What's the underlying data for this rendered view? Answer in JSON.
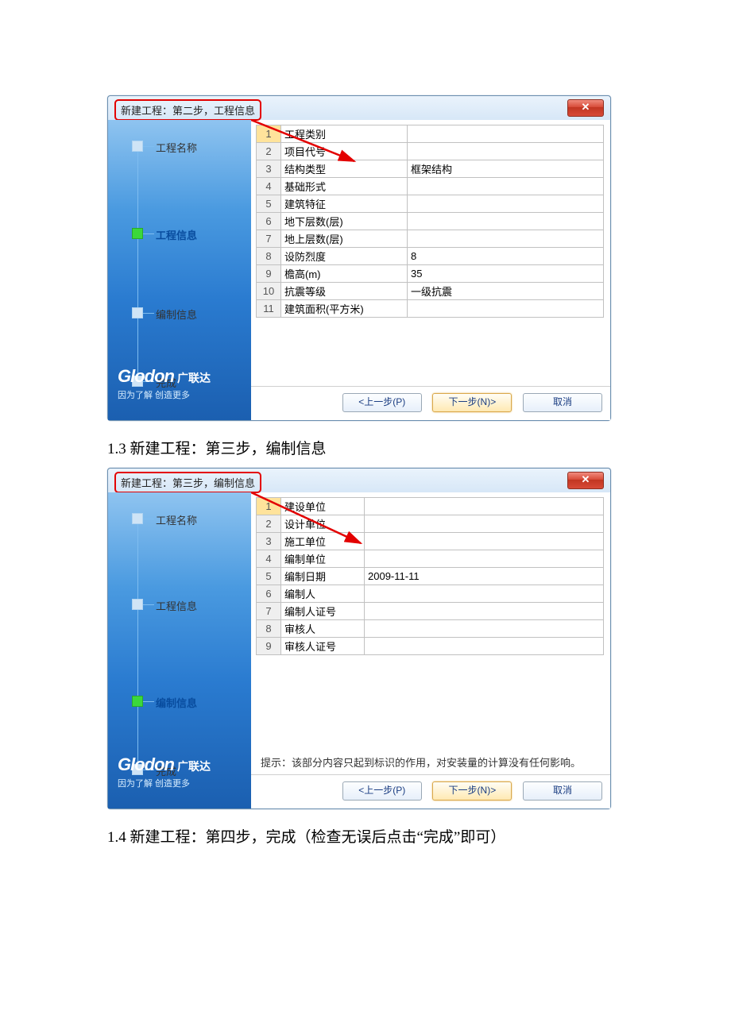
{
  "dialog1": {
    "title": "新建工程：第二步，工程信息",
    "close_glyph": "✕",
    "steps": [
      {
        "label": "工程名称",
        "active": false
      },
      {
        "label": "工程信息",
        "active": true
      },
      {
        "label": "编制信息",
        "active": false
      },
      {
        "label": "完成",
        "active": false
      }
    ],
    "rows": [
      {
        "n": "1",
        "label": "工程类别",
        "value": ""
      },
      {
        "n": "2",
        "label": "项目代号",
        "value": ""
      },
      {
        "n": "3",
        "label": "结构类型",
        "value": "框架结构"
      },
      {
        "n": "4",
        "label": "基础形式",
        "value": ""
      },
      {
        "n": "5",
        "label": "建筑特征",
        "value": ""
      },
      {
        "n": "6",
        "label": "地下层数(层)",
        "value": ""
      },
      {
        "n": "7",
        "label": "地上层数(层)",
        "value": ""
      },
      {
        "n": "8",
        "label": "设防烈度",
        "value": "8"
      },
      {
        "n": "9",
        "label": "檐高(m)",
        "value": "35"
      },
      {
        "n": "10",
        "label": "抗震等级",
        "value": "一级抗震"
      },
      {
        "n": "11",
        "label": "建筑面积(平方米)",
        "value": ""
      }
    ],
    "buttons": {
      "prev": "<上一步(P)",
      "next": "下一步(N)>",
      "cancel": "取消"
    },
    "brand": {
      "logo": "Glodon",
      "cn": "广联达",
      "sub": "因为了解 创造更多"
    }
  },
  "caption1": "1.3 新建工程：第三步，编制信息",
  "dialog2": {
    "title": "新建工程：第三步，编制信息",
    "close_glyph": "✕",
    "steps": [
      {
        "label": "工程名称",
        "active": false
      },
      {
        "label": "工程信息",
        "active": false
      },
      {
        "label": "编制信息",
        "active": true
      },
      {
        "label": "完成",
        "active": false
      }
    ],
    "rows": [
      {
        "n": "1",
        "label": "建设单位",
        "value": ""
      },
      {
        "n": "2",
        "label": "设计单位",
        "value": ""
      },
      {
        "n": "3",
        "label": "施工单位",
        "value": ""
      },
      {
        "n": "4",
        "label": "编制单位",
        "value": ""
      },
      {
        "n": "5",
        "label": "编制日期",
        "value": "2009-11-11"
      },
      {
        "n": "6",
        "label": "编制人",
        "value": ""
      },
      {
        "n": "7",
        "label": "编制人证号",
        "value": ""
      },
      {
        "n": "8",
        "label": "审核人",
        "value": ""
      },
      {
        "n": "9",
        "label": "审核人证号",
        "value": ""
      }
    ],
    "hint": "提示：该部分内容只起到标识的作用，对安装量的计算没有任何影响。",
    "buttons": {
      "prev": "<上一步(P)",
      "next": "下一步(N)>",
      "cancel": "取消"
    },
    "brand": {
      "logo": "Glodon",
      "cn": "广联达",
      "sub": "因为了解 创造更多"
    }
  },
  "caption2": "1.4 新建工程：第四步，完成（检查无误后点击“完成”即可）"
}
